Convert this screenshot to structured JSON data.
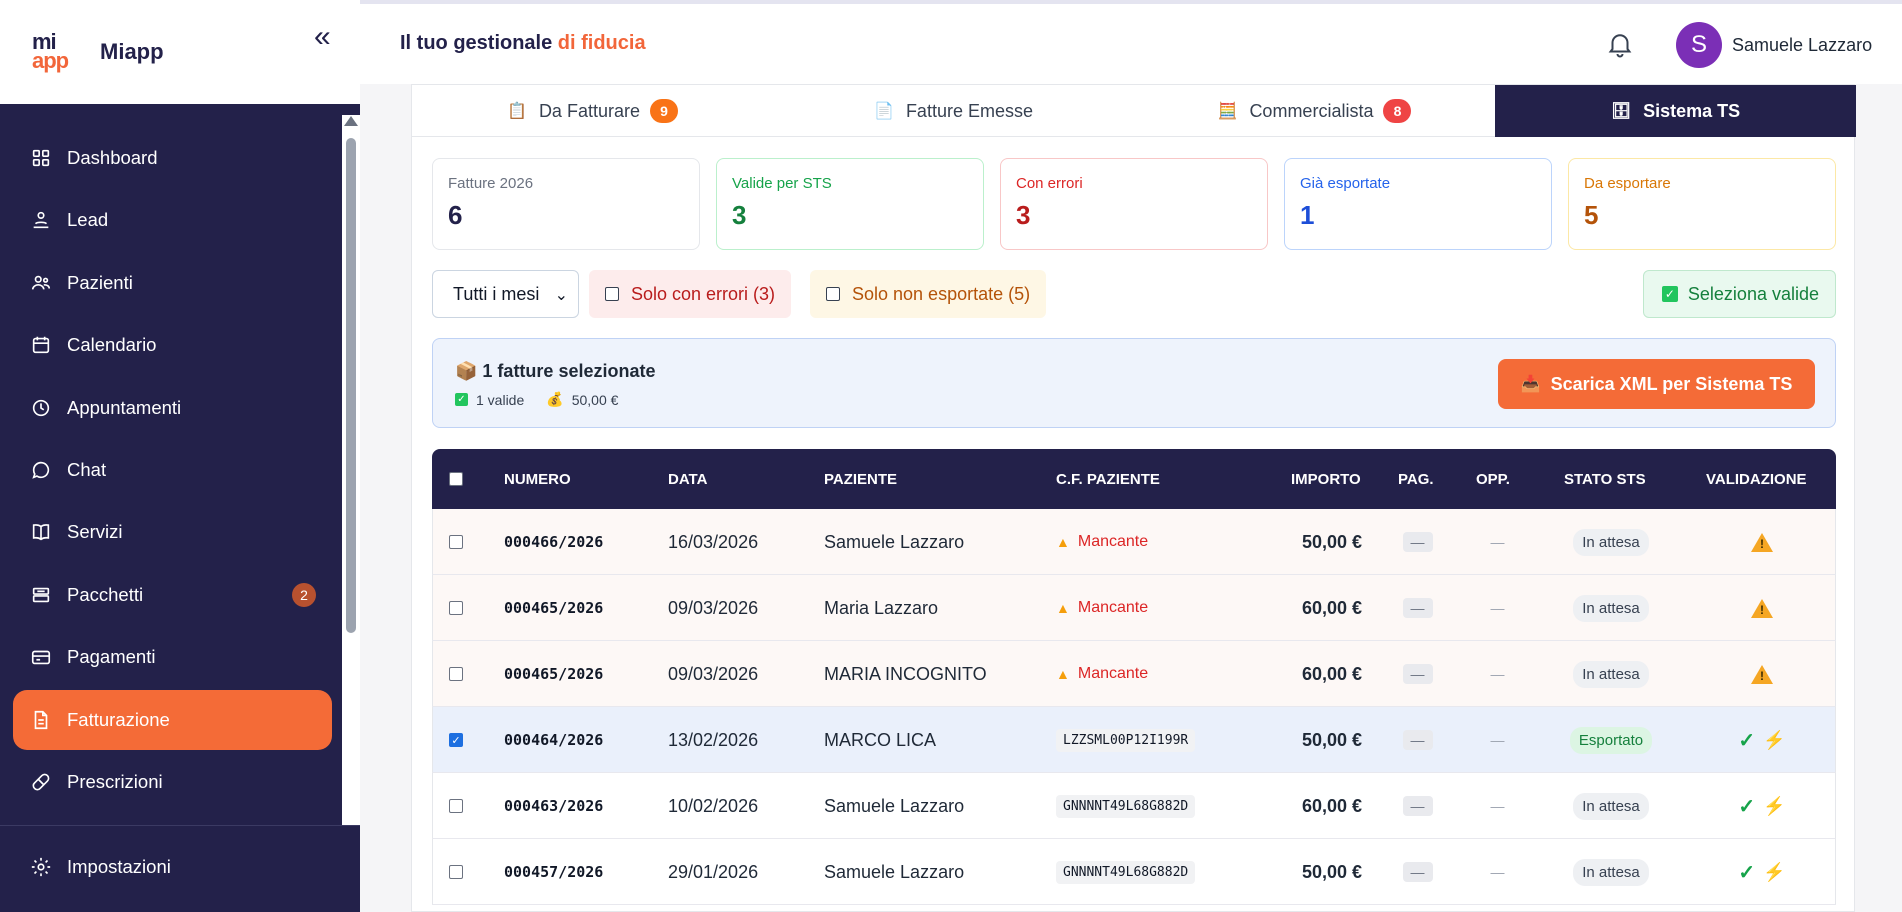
{
  "brand": {
    "logo_top": "mi",
    "logo_bottom": "app",
    "name": "Miapp",
    "collapse_glyph": "«"
  },
  "header": {
    "title_main": "Il tuo gestionale ",
    "title_accent": "di fiducia",
    "user_initial": "S",
    "user_name": "Samuele Lazzaro"
  },
  "sidebar": {
    "items": [
      {
        "label": "Dashboard",
        "icon": "dashboard-icon"
      },
      {
        "label": "Lead",
        "icon": "user-hand-icon"
      },
      {
        "label": "Pazienti",
        "icon": "users-icon"
      },
      {
        "label": "Calendario",
        "icon": "calendar-icon"
      },
      {
        "label": "Appuntamenti",
        "icon": "clock-icon"
      },
      {
        "label": "Chat",
        "icon": "chat-icon"
      },
      {
        "label": "Servizi",
        "icon": "book-icon"
      },
      {
        "label": "Pacchetti",
        "icon": "package-icon",
        "badge": "2"
      },
      {
        "label": "Pagamenti",
        "icon": "card-icon"
      },
      {
        "label": "Fatturazione",
        "icon": "document-icon",
        "active": true
      },
      {
        "label": "Prescrizioni",
        "icon": "pill-icon"
      }
    ],
    "settings": {
      "label": "Impostazioni",
      "icon": "gear-icon"
    }
  },
  "tabs": [
    {
      "label": "Da Fatturare",
      "icon": "📋",
      "badge": "9",
      "badge_color": "#f97316"
    },
    {
      "label": "Fatture Emesse",
      "icon": "📄"
    },
    {
      "label": "Commercialista",
      "icon": "🧮",
      "badge": "8",
      "badge_color": "#ef4444"
    },
    {
      "label": "Sistema TS",
      "icon": "🗄",
      "active": true
    }
  ],
  "stats": [
    {
      "label": "Fatture 2026",
      "value": "6",
      "label_color": "#6b7280",
      "value_color": "#23214a",
      "border": "#e5e7eb"
    },
    {
      "label": "Valide per STS",
      "value": "3",
      "label_color": "#16a34a",
      "value_color": "#15803d",
      "border": "#bbf0cc"
    },
    {
      "label": "Con errori",
      "value": "3",
      "label_color": "#dc2626",
      "value_color": "#b91c1c",
      "border": "#f8c7c7"
    },
    {
      "label": "Già esportate",
      "value": "1",
      "label_color": "#2563eb",
      "value_color": "#1d4ed8",
      "border": "#bcd4fb"
    },
    {
      "label": "Da esportare",
      "value": "5",
      "label_color": "#d97706",
      "value_color": "#b45309",
      "border": "#fce8a6"
    }
  ],
  "filters": {
    "month_select": "Tutti i mesi",
    "errors_only": "Solo con errori (3)",
    "not_exported_only": "Solo non esportate (5)",
    "select_valid": "Seleziona valide"
  },
  "selection": {
    "title": "1 fatture selezionate",
    "valid": "1 valide",
    "amount": "50,00 €",
    "download_button": "Scarica XML per Sistema TS"
  },
  "table": {
    "headers": {
      "numero": "NUMERO",
      "data": "DATA",
      "paziente": "PAZIENTE",
      "cf": "C.F. PAZIENTE",
      "importo": "IMPORTO",
      "pag": "PAG.",
      "opp": "OPP.",
      "stato": "STATO STS",
      "validazione": "VALIDAZIONE"
    },
    "rows": [
      {
        "numero": "000466/2026",
        "data": "16/03/2026",
        "paziente": "Samuele Lazzaro",
        "cf": "",
        "cf_missing": "Mancante",
        "importo": "50,00 €",
        "pag": "—",
        "opp": "—",
        "stato": "In attesa",
        "valid": false,
        "checked": false
      },
      {
        "numero": "000465/2026",
        "data": "09/03/2026",
        "paziente": "Maria Lazzaro",
        "cf": "",
        "cf_missing": "Mancante",
        "importo": "60,00 €",
        "pag": "—",
        "opp": "—",
        "stato": "In attesa",
        "valid": false,
        "checked": false
      },
      {
        "numero": "000465/2026",
        "data": "09/03/2026",
        "paziente": "MARIA INCOGNITO",
        "cf": "",
        "cf_missing": "Mancante",
        "importo": "60,00 €",
        "pag": "—",
        "opp": "—",
        "stato": "In attesa",
        "valid": false,
        "checked": false
      },
      {
        "numero": "000464/2026",
        "data": "13/02/2026",
        "paziente": "MARCO LICA",
        "cf": "LZZSML00P12I199R",
        "importo": "50,00 €",
        "pag": "—",
        "opp": "—",
        "stato": "Esportato",
        "valid": true,
        "checked": true
      },
      {
        "numero": "000463/2026",
        "data": "10/02/2026",
        "paziente": "Samuele Lazzaro",
        "cf": "GNNNNT49L68G882D",
        "importo": "60,00 €",
        "pag": "—",
        "opp": "—",
        "stato": "In attesa",
        "valid": true,
        "checked": false
      },
      {
        "numero": "000457/2026",
        "data": "29/01/2026",
        "paziente": "Samuele Lazzaro",
        "cf": "GNNNNT49L68G882D",
        "importo": "50,00 €",
        "pag": "—",
        "opp": "—",
        "stato": "In attesa",
        "valid": true,
        "checked": false
      }
    ]
  },
  "colors": {
    "sidebar": "#23214a",
    "accent": "#f46b37",
    "table_header": "#23214a"
  }
}
